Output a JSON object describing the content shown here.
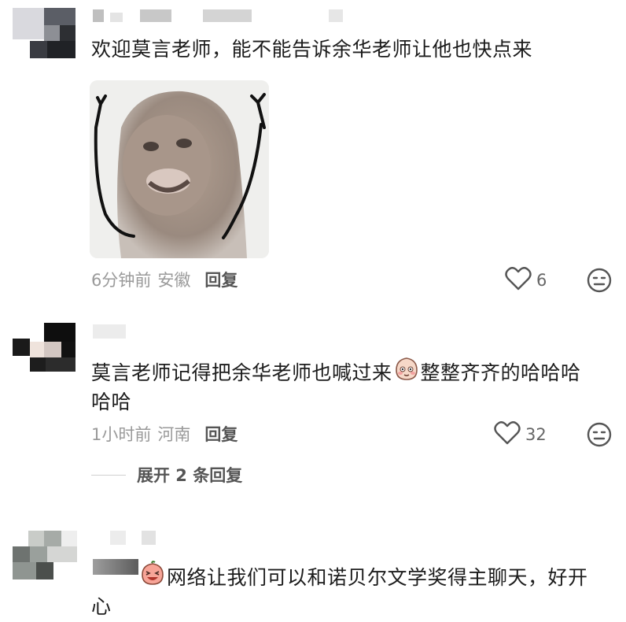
{
  "comments": [
    {
      "text": "欢迎莫言老师，能不能告诉余华老师让他也快点来",
      "time": "6分钟前",
      "location": "安徽",
      "reply": "回复",
      "likes": "6",
      "image_desc": "monkey-meme"
    },
    {
      "text_before_emoji": "莫言老师记得把余华老师也喊过来",
      "text_after_emoji": "整整齐齐的哈哈哈",
      "text_line2": "哈哈",
      "time": "1小时前",
      "location": "河南",
      "reply": "回复",
      "likes": "32",
      "expand_label": "展开 2 条回复"
    },
    {
      "text_line1": "网络让我们可以和诺贝尔文学奖得主聊天，好开",
      "text_line2": "心"
    }
  ],
  "icons": {
    "like": "heart-icon",
    "dislike": "meh-face-icon",
    "emoji": "blush-emoji-icon"
  }
}
